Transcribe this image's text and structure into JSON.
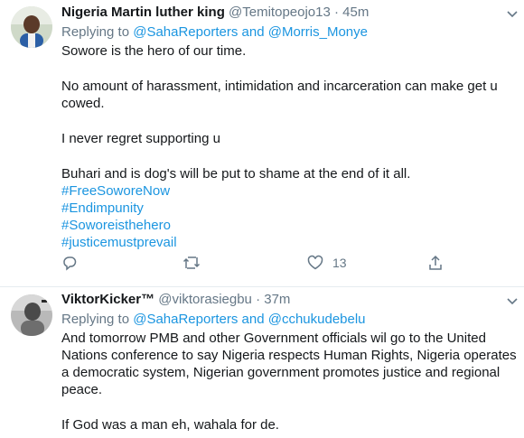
{
  "tweets": [
    {
      "name": "Nigeria Martin luther king",
      "handle": "@Temitopeojo13",
      "time": "45m",
      "replying_to": "Replying to",
      "mentions": [
        "@SahaReporters",
        "@Morris_Monye"
      ],
      "and": "and",
      "paragraphs": [
        "Sowore is the hero of our time.",
        "No amount of harassment, intimidation and incarceration can make  get u cowed.",
        "I never regret supporting u",
        "Buhari and is dog's will be put to shame at the end of it all."
      ],
      "hashtags": [
        "#FreeSoworeNow",
        "#Endimpunity",
        "#Soworeisthehero",
        "#justicemustprevail"
      ],
      "likes": "13"
    },
    {
      "name": "ViktorKicker™",
      "handle": "@viktorasiegbu",
      "time": "37m",
      "replying_to": "Replying to",
      "mentions": [
        "@SahaReporters",
        "@cchukudebelu"
      ],
      "and": "and",
      "paragraphs": [
        "And tomorrow PMB and other Government officials wil go to the United Nations conference to say Nigeria respects Human Rights, Nigeria operates a democratic system, Nigerian government promotes justice and  regional peace.",
        "If God was a man eh,  wahala for de."
      ]
    }
  ],
  "colors": {
    "link": "#1b95e0",
    "secondary": "#657786",
    "divider": "#e6ecf0"
  },
  "icons": [
    "reply-icon",
    "retweet-icon",
    "like-icon",
    "share-icon",
    "chevron-down-icon"
  ]
}
